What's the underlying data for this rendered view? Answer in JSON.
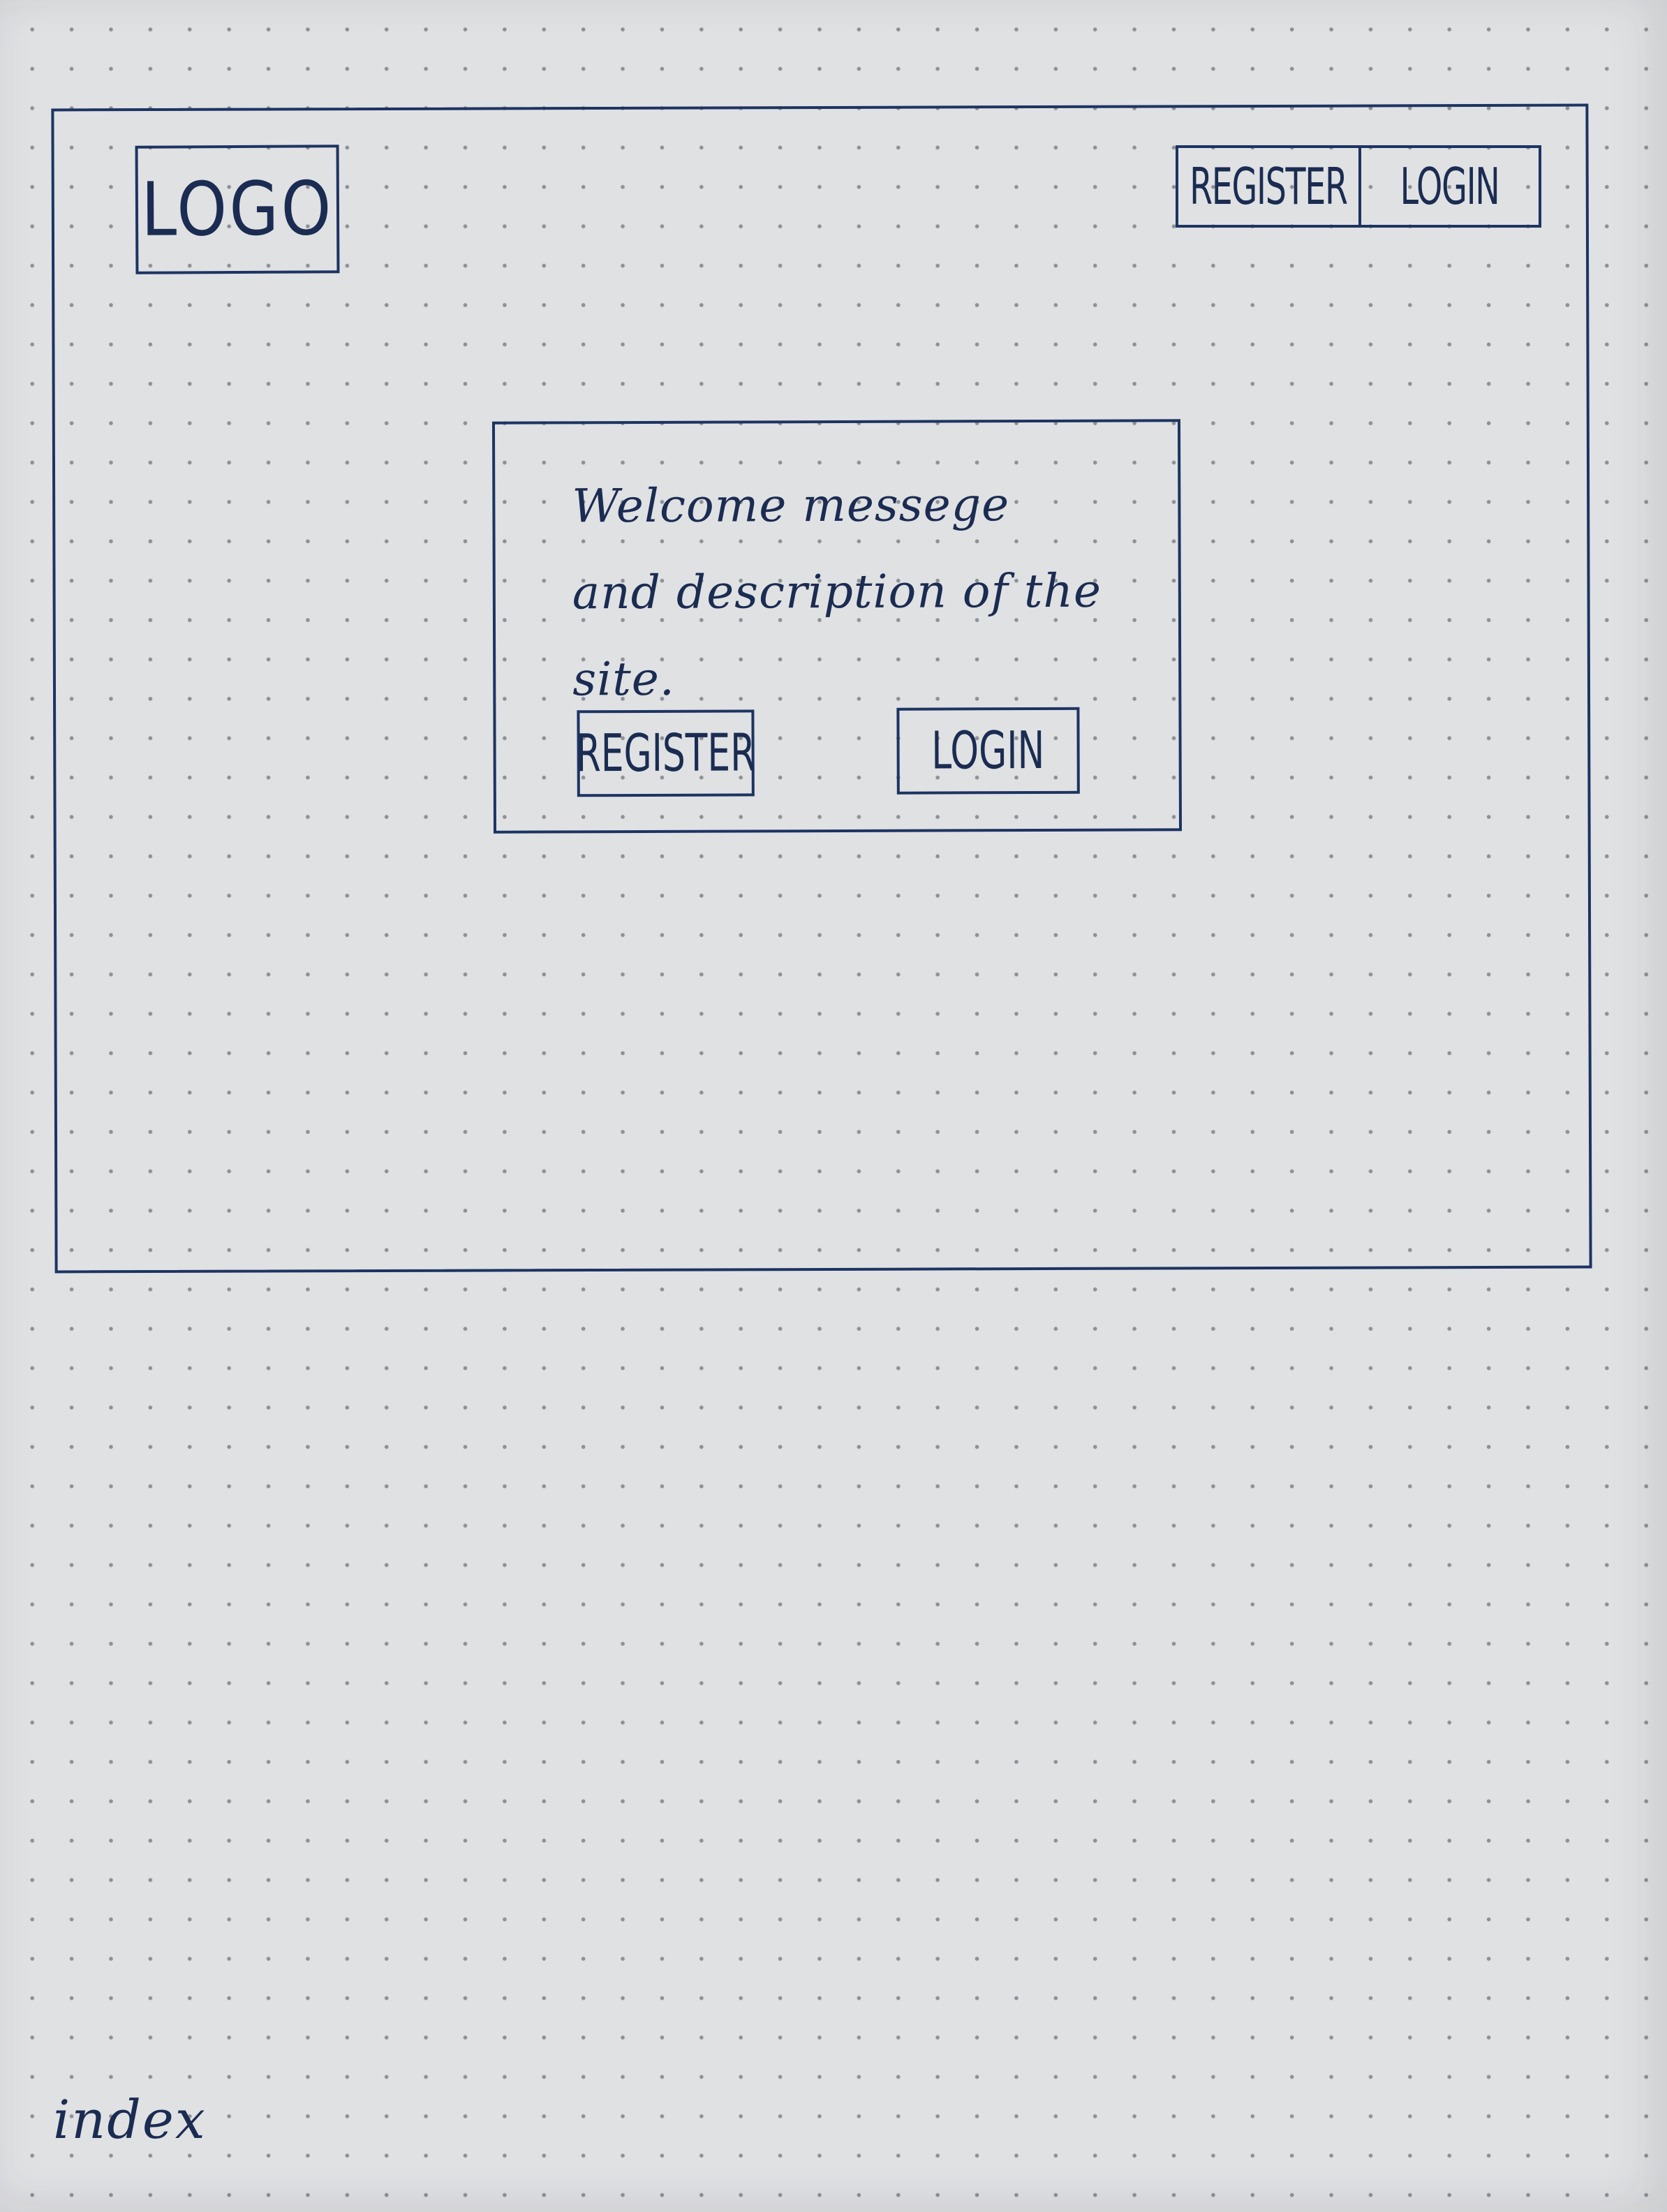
{
  "header": {
    "logo": "LOGO",
    "nav": {
      "register_label": "REGISTER",
      "login_label": "LOGIN"
    }
  },
  "card": {
    "welcome_text": "Welcome messege and description of the site.",
    "register_label": "REGISTER",
    "login_label": "LOGIN"
  },
  "page_label": "index",
  "colors": {
    "ink": "#1d3462",
    "paper": "#e0e1e3",
    "dot": "#8e9096"
  }
}
